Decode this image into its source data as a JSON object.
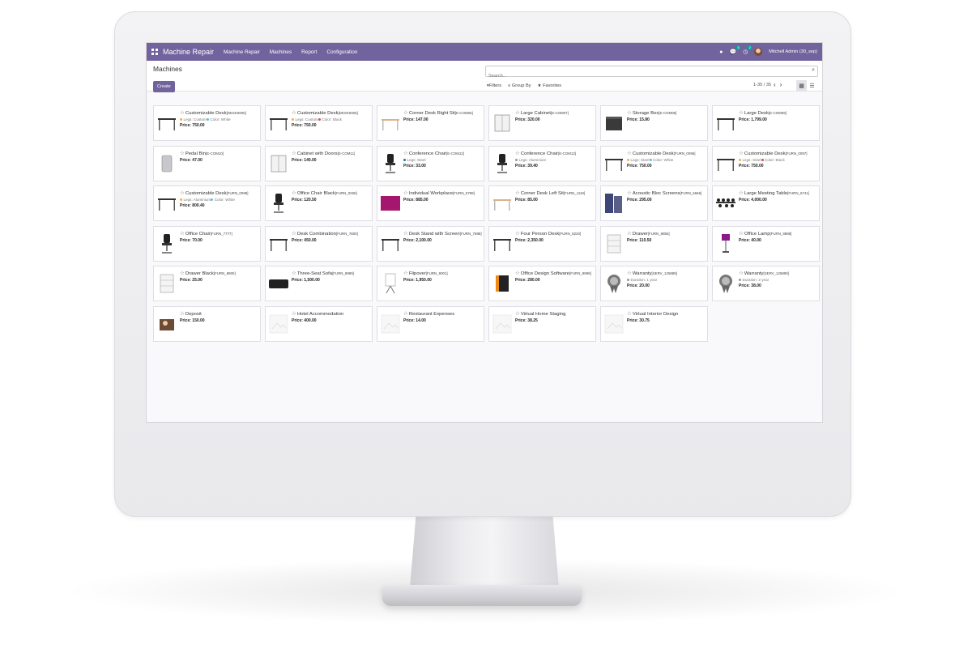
{
  "navbar": {
    "app_title": "Machine Repair",
    "menus": [
      "Machine Repair",
      "Machines",
      "Report",
      "Configuration"
    ],
    "activity_count": "5",
    "message_count": "2",
    "user_name": "Mitchell Admin (30_sep)",
    "color": "#71639e"
  },
  "control_panel": {
    "breadcrumb": "Machines",
    "create_label": "Create",
    "search_placeholder": "Search...",
    "filters_label": "Filters",
    "group_by_label": "Group By",
    "favorites_label": "Favorites",
    "pager": "1-35 / 35"
  },
  "cards": [
    {
      "name": "Customizable Desk",
      "ref": "[DESK0005]",
      "attrs": [
        {
          "text": "Legs: Custom",
          "color": "#f0ad4e"
        },
        {
          "text": "Color: White",
          "color": "#5bc0de"
        }
      ],
      "price": "750.00",
      "icon": "desk-icon"
    },
    {
      "name": "Customizable Desk",
      "ref": "[DESK0006]",
      "attrs": [
        {
          "text": "Legs: Custom",
          "color": "#f0ad4e"
        },
        {
          "text": "Color: Black",
          "color": "#d9534f"
        }
      ],
      "price": "750.00",
      "icon": "desk-icon"
    },
    {
      "name": "Corner Desk Right Sit",
      "ref": "[E-COM06]",
      "attrs": [],
      "price": "147.00",
      "icon": "corner-desk-icon"
    },
    {
      "name": "Large Cabinet",
      "ref": "[E-COM07]",
      "attrs": [],
      "price": "320.00",
      "icon": "cabinet-icon"
    },
    {
      "name": "Storage Box",
      "ref": "[E-COM08]",
      "attrs": [],
      "price": "15.80",
      "icon": "storage-box-icon"
    },
    {
      "name": "Large Desk",
      "ref": "[E-COM09]",
      "attrs": [],
      "price": "1,799.00",
      "icon": "desk-icon"
    },
    {
      "name": "Pedal Bin",
      "ref": "[E-COM10]",
      "attrs": [],
      "price": "47.00",
      "icon": "bin-icon"
    },
    {
      "name": "Cabinet with Doors",
      "ref": "[E-COM11]",
      "attrs": [],
      "price": "140.00",
      "icon": "cabinet-icon"
    },
    {
      "name": "Conference Chair",
      "ref": "[E-COM12]",
      "attrs": [
        {
          "text": "Legs: Steel",
          "color": "#1f77b4"
        }
      ],
      "price": "33.00",
      "icon": "chair-icon"
    },
    {
      "name": "Conference Chair",
      "ref": "[E-COM13]",
      "attrs": [
        {
          "text": "Legs: Aluminium",
          "color": "#999999"
        }
      ],
      "price": "39.40",
      "icon": "chair-icon"
    },
    {
      "name": "Customizable Desk",
      "ref": "[FURN_0096]",
      "attrs": [
        {
          "text": "Legs: Steel",
          "color": "#f0ad4e"
        },
        {
          "text": "Color: White",
          "color": "#5bc0de"
        }
      ],
      "price": "750.00",
      "icon": "desk-icon"
    },
    {
      "name": "Customizable Desk",
      "ref": "[FURN_0097]",
      "attrs": [
        {
          "text": "Legs: Steel",
          "color": "#f0ad4e"
        },
        {
          "text": "Color: Black",
          "color": "#d9534f"
        }
      ],
      "price": "750.00",
      "icon": "desk-icon"
    },
    {
      "name": "Customizable Desk",
      "ref": "[FURN_0098]",
      "attrs": [
        {
          "text": "Legs: Aluminium",
          "color": "#f0ad4e"
        },
        {
          "text": "Color: White",
          "color": "#5bc0de"
        }
      ],
      "price": "800.40",
      "icon": "desk-icon"
    },
    {
      "name": "Office Chair Black",
      "ref": "[FURN_0269]",
      "attrs": [],
      "price": "120.50",
      "icon": "chair-icon"
    },
    {
      "name": "Individual Workplace",
      "ref": "[FURN_0789]",
      "attrs": [],
      "price": "885.00",
      "icon": "workplace-icon"
    },
    {
      "name": "Corner Desk Left Sit",
      "ref": "[FURN_1118]",
      "attrs": [],
      "price": "85.00",
      "icon": "corner-desk-icon"
    },
    {
      "name": "Acoustic Bloc Screens",
      "ref": "[FURN_6666]",
      "attrs": [],
      "price": "295.00",
      "icon": "screen-icon"
    },
    {
      "name": "Large Meeting Table",
      "ref": "[FURN_6741]",
      "attrs": [],
      "price": "4,000.00",
      "icon": "table-icon"
    },
    {
      "name": "Office Chair",
      "ref": "[FURN_7777]",
      "attrs": [],
      "price": "70.00",
      "icon": "chair-icon"
    },
    {
      "name": "Desk Combination",
      "ref": "[FURN_7800]",
      "attrs": [],
      "price": "450.00",
      "icon": "desk-icon"
    },
    {
      "name": "Desk Stand with Screen",
      "ref": "[FURN_7888]",
      "attrs": [],
      "price": "2,100.00",
      "icon": "desk-icon"
    },
    {
      "name": "Four Person Desk",
      "ref": "[FURN_8220]",
      "attrs": [],
      "price": "2,350.00",
      "icon": "desk-icon"
    },
    {
      "name": "Drawer",
      "ref": "[FURN_8855]",
      "attrs": [],
      "price": "110.50",
      "icon": "drawer-icon"
    },
    {
      "name": "Office Lamp",
      "ref": "[FURN_8888]",
      "attrs": [],
      "price": "40.00",
      "icon": "lamp-icon"
    },
    {
      "name": "Drawer Black",
      "ref": "[FURN_8900]",
      "attrs": [],
      "price": "25.00",
      "icon": "drawer-icon"
    },
    {
      "name": "Three-Seat Sofa",
      "ref": "[FURN_8999]",
      "attrs": [],
      "price": "1,500.00",
      "icon": "sofa-icon"
    },
    {
      "name": "Flipover",
      "ref": "[FURN_9001]",
      "attrs": [],
      "price": "1,950.00",
      "icon": "flipover-icon"
    },
    {
      "name": "Office Design Software",
      "ref": "[FURN_9999]",
      "attrs": [],
      "price": "280.00",
      "icon": "software-box-icon"
    },
    {
      "name": "Warranty",
      "ref": "[SERV_125889]",
      "attrs": [
        {
          "text": "Duration: 1 year",
          "color": "#999999"
        }
      ],
      "price": "20.00",
      "icon": "warranty-badge-icon"
    },
    {
      "name": "Warranty",
      "ref": "[SERV_125890]",
      "attrs": [
        {
          "text": "Duration: 2 year",
          "color": "#999999"
        }
      ],
      "price": "38.00",
      "icon": "warranty-badge-icon"
    },
    {
      "name": "Deposit",
      "ref": "",
      "attrs": [],
      "price": "150.00",
      "icon": "deposit-icon"
    },
    {
      "name": "Hotel Accommodation",
      "ref": "",
      "attrs": [],
      "price": "400.00",
      "icon": "placeholder-image-icon"
    },
    {
      "name": "Restaurant Expenses",
      "ref": "",
      "attrs": [],
      "price": "14.00",
      "icon": "placeholder-image-icon"
    },
    {
      "name": "Virtual Home Staging",
      "ref": "",
      "attrs": [],
      "price": "38.25",
      "icon": "placeholder-image-icon"
    },
    {
      "name": "Virtual Interior Design",
      "ref": "",
      "attrs": [],
      "price": "30.75",
      "icon": "placeholder-image-icon"
    }
  ],
  "price_prefix": "Price: "
}
